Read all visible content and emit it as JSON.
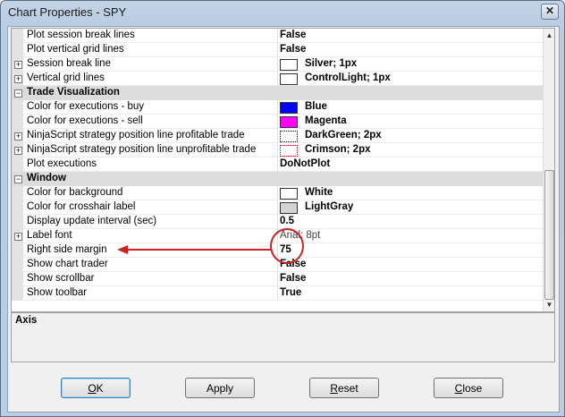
{
  "window": {
    "title": "Chart Properties - SPY",
    "close_glyph": "✕"
  },
  "grid": {
    "rows": [
      {
        "kind": "prop",
        "expand": false,
        "name": "Plot session break lines",
        "value": "False"
      },
      {
        "kind": "prop",
        "expand": false,
        "name": "Plot vertical grid lines",
        "value": "False"
      },
      {
        "kind": "prop",
        "expand": true,
        "name": "Session break line",
        "value": "Silver; 1px",
        "swatch": "#ffffff",
        "swatch_style": "solid"
      },
      {
        "kind": "prop",
        "expand": true,
        "name": "Vertical grid lines",
        "value": "ControlLight; 1px",
        "swatch": "#ffffff",
        "swatch_style": "solid"
      },
      {
        "kind": "cat",
        "name": "Trade Visualization"
      },
      {
        "kind": "prop",
        "expand": false,
        "name": "Color for executions - buy",
        "value": "Blue",
        "swatch": "#0000ff",
        "swatch_style": "solid"
      },
      {
        "kind": "prop",
        "expand": false,
        "name": "Color for executions - sell",
        "value": "Magenta",
        "swatch": "#ff00ff",
        "swatch_style": "solid"
      },
      {
        "kind": "prop",
        "expand": true,
        "name": "NinjaScript strategy position line profitable trade",
        "value": "DarkGreen; 2px",
        "swatch": "#ffffff",
        "swatch_style": "dotted"
      },
      {
        "kind": "prop",
        "expand": true,
        "name": "NinjaScript strategy position line unprofitable trade",
        "value": "Crimson; 2px",
        "swatch": "#ffffff",
        "swatch_style": "dotted-red"
      },
      {
        "kind": "prop",
        "expand": false,
        "name": "Plot executions",
        "value": "DoNotPlot"
      },
      {
        "kind": "cat",
        "name": "Window"
      },
      {
        "kind": "prop",
        "expand": false,
        "name": "Color for background",
        "value": "White",
        "swatch": "#ffffff",
        "swatch_style": "solid"
      },
      {
        "kind": "prop",
        "expand": false,
        "name": "Color for crosshair label",
        "value": "LightGray",
        "swatch": "#d3d3d3",
        "swatch_style": "solid"
      },
      {
        "kind": "prop",
        "expand": false,
        "name": "Display update interval (sec)",
        "value": "0.5"
      },
      {
        "kind": "prop",
        "expand": true,
        "name": "Label font",
        "value": "Arial; 8pt",
        "light": true
      },
      {
        "kind": "prop",
        "expand": false,
        "name": "Right side margin",
        "value": "75"
      },
      {
        "kind": "prop",
        "expand": false,
        "name": "Show chart trader",
        "value": "False"
      },
      {
        "kind": "prop",
        "expand": false,
        "name": "Show scrollbar",
        "value": "False"
      },
      {
        "kind": "prop",
        "expand": false,
        "name": "Show toolbar",
        "value": "True"
      }
    ]
  },
  "description": {
    "title": "Axis"
  },
  "buttons": {
    "ok": {
      "mnemonic": "O",
      "rest": "K"
    },
    "apply": {
      "label": "Apply"
    },
    "reset": {
      "mnemonic": "R",
      "rest": "eset"
    },
    "close": {
      "mnemonic": "C",
      "rest": "lose"
    }
  },
  "annotation_color": "#cc2222"
}
